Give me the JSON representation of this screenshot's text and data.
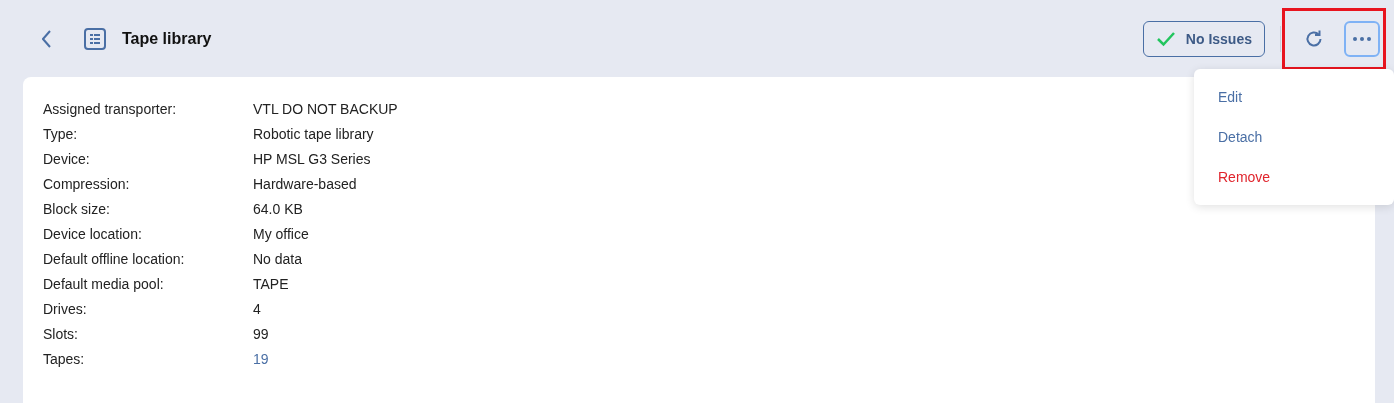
{
  "header": {
    "title": "Tape library",
    "status": {
      "label": "No Issues",
      "kind": "ok"
    },
    "more_button": {
      "highlighted": true,
      "expanded": true
    }
  },
  "details": [
    {
      "label": "Assigned transporter:",
      "value": "VTL DO NOT BACKUP",
      "kind": "text"
    },
    {
      "label": "Type:",
      "value": "Robotic tape library",
      "kind": "text"
    },
    {
      "label": "Device:",
      "value": "HP MSL G3 Series",
      "kind": "text"
    },
    {
      "label": "Compression:",
      "value": "Hardware-based",
      "kind": "text"
    },
    {
      "label": "Block size:",
      "value": "64.0 KB",
      "kind": "text"
    },
    {
      "label": "Device location:",
      "value": "My office",
      "kind": "text"
    },
    {
      "label": "Default offline location:",
      "value": "No data",
      "kind": "text"
    },
    {
      "label": "Default media pool:",
      "value": "TAPE",
      "kind": "text"
    },
    {
      "label": "Drives:",
      "value": "4",
      "kind": "text"
    },
    {
      "label": "Slots:",
      "value": "99",
      "kind": "text"
    },
    {
      "label": "Tapes:",
      "value": "19",
      "kind": "link"
    }
  ],
  "menu": [
    {
      "label": "Edit",
      "kind": "normal"
    },
    {
      "label": "Detach",
      "kind": "normal"
    },
    {
      "label": "Remove",
      "kind": "danger"
    }
  ]
}
